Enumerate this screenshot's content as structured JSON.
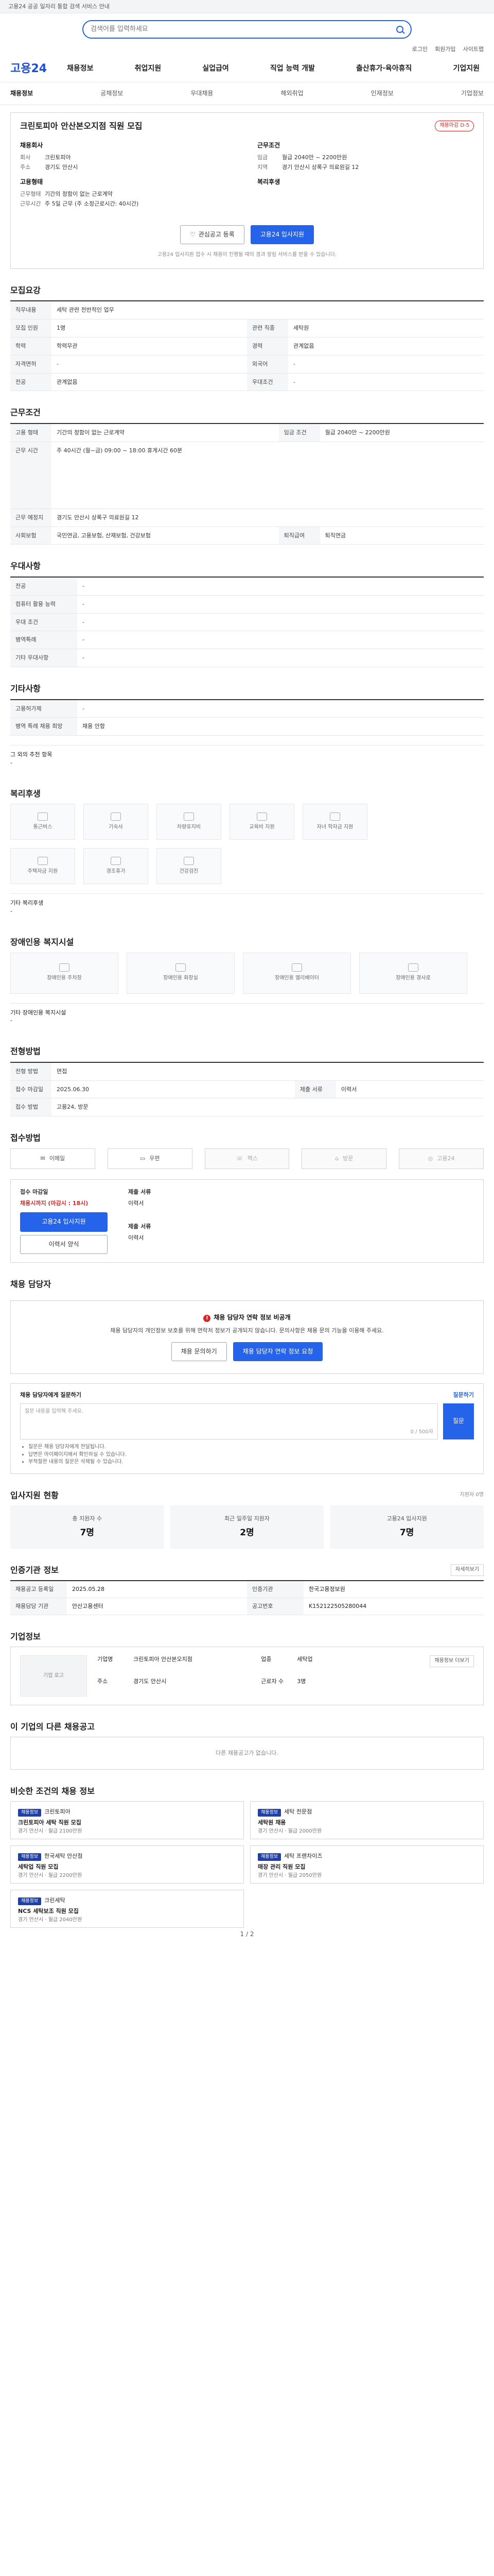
{
  "top": {
    "text": "고용24 공공 일자리 통합 검색 서비스 안내",
    "notice": ""
  },
  "search": {
    "placeholder": "검색어를 입력하세요"
  },
  "util": [
    "로그인",
    "회원가입",
    "사이트맵"
  ],
  "logo": "고용24",
  "gnb": [
    "채용정보",
    "취업지원",
    "실업급여",
    "직업 능력 개발",
    "출산휴가·육아휴직",
    "기업지원"
  ],
  "subnav": [
    "채용정보",
    "공채정보",
    "우대채용",
    "해외취업",
    "인재정보",
    "기업정보"
  ],
  "job": {
    "title": "크린토피아 안산본오지점 직원 모집",
    "dday": "채용마감 D-5",
    "company_h": "채용회사",
    "company_rows": [
      {
        "k": "회사",
        "v": "크린토피아"
      },
      {
        "k": "주소",
        "v": "경기도 안산시"
      }
    ],
    "cond_h": "근무조건",
    "cond_rows": [
      {
        "k": "임금",
        "v": "월급 2040만 ~ 2200만원"
      },
      {
        "k": "지역",
        "v": "경기 안산시 상록구 의료원길 12"
      }
    ],
    "emp_h": "고용형태",
    "emp_rows": [
      {
        "k": "근무형태",
        "v": "기간의 정함이 없는 근로계약"
      },
      {
        "k": "근무시간",
        "v": "주 5일 근무 (주 소정근로시간: 40시간)"
      }
    ],
    "welfare_h": "복리후생",
    "welfare_rows": []
  },
  "actions": {
    "scrap": "관심공고 등록",
    "apply": "고용24 입사지원"
  },
  "notice": "고용24 입사지원 접수 시 채용이 진행될 때의 결과 알림 서비스를 받을 수 있습니다.",
  "req": {
    "title": "모집요강",
    "rows": [
      {
        "k": "직무내용",
        "v": "세탁 관련 전반적인 업무",
        "full": true
      },
      {
        "k": "모집 인원",
        "v": "1명",
        "k2": "관련 직종",
        "v2": "세탁원"
      },
      {
        "k": "학력",
        "v": "학력무관",
        "k2": "경력",
        "v2": "관계없음"
      },
      {
        "k": "자격면허",
        "v": "-",
        "k2": "외국어",
        "v2": "-"
      },
      {
        "k": "전공",
        "v": "관계없음",
        "k2": "우대조건",
        "v2": "-"
      }
    ]
  },
  "work": {
    "title": "근무조건",
    "rows": [
      {
        "k": "고용 형태",
        "v": "기간의 정함이 없는 근로계약",
        "k2": "임금 조건",
        "v2": "월급 2040만 ~ 2200만원"
      },
      {
        "k": "근무 시간",
        "v": "주 40시간 (월~금) 09:00 ~ 18:00 휴게시간 60분",
        "k2": "",
        "v2": ""
      },
      {
        "k": "근무 예정지",
        "v": "경기도 안산시 상록구 의료원길 12",
        "k2": "",
        "v2": ""
      },
      {
        "k": "사회보험",
        "v": "국민연금, 고용보험, 산재보험, 건강보험",
        "k2": "퇴직급여",
        "v2": "퇴직연금"
      }
    ]
  },
  "pref": {
    "title": "우대사항",
    "rows": [
      {
        "k": "전공",
        "v": "-"
      },
      {
        "k": "컴퓨터 활용 능력",
        "v": "-"
      },
      {
        "k": "우대 조건",
        "v": "-"
      },
      {
        "k": "병역특례",
        "v": "-"
      },
      {
        "k": "기타 우대사항",
        "v": "-"
      }
    ]
  },
  "etc": {
    "title": "기타사항",
    "rows": [
      {
        "k": "고용허가제",
        "v": "-"
      },
      {
        "k": "병역 특례 채용 희망",
        "v": "채용 안함"
      }
    ],
    "extra_h": "그 외의 추천 항목",
    "extra": "-"
  },
  "welfare": {
    "title": "복리후생",
    "items": [
      "통근버스",
      "기숙사",
      "차량유지비",
      "교육비 지원",
      "자녀 학자금 지원",
      "주택자금 지원",
      "경조휴가",
      "건강검진"
    ],
    "etc_h": "기타 복리후생",
    "etc": "-"
  },
  "disabled": {
    "title": "장애인용 복지시설",
    "items": [
      "장애인용 주차장",
      "장애인용 화장실",
      "장애인용 엘리베이터",
      "장애인용 경사로"
    ],
    "etc_h": "기타 장애인용 복지시설",
    "etc": "-"
  },
  "process": {
    "title": "전형방법",
    "rows": [
      {
        "k": "전형 방법",
        "v": "면접"
      },
      {
        "k": "접수 마감일",
        "v": "2025.06.30",
        "k2": "제출 서류",
        "v2": "이력서"
      },
      {
        "k": "접수 방법",
        "v": "고용24, 방문"
      }
    ]
  },
  "methods": {
    "title": "접수방법",
    "items": [
      "이메일",
      "우편",
      "팩스",
      "방문",
      "고용24"
    ]
  },
  "apply": {
    "h1": "접수 마감일",
    "red": "채용시까지 (마감시 : 18시)",
    "btn1": "고용24 입사지원",
    "btn2": "이력서 양식",
    "h2": "제출 서류",
    "v2": "이력서",
    "h3": "제출 서류",
    "v3": "이력서"
  },
  "contact": {
    "title": "채용 담당자",
    "warn": "채용 담당자 연락 정보 비공개",
    "text": "채용 담당자의 개인정보 보호를 위해 연락처 정보가 공개되지 않습니다. 문의사항은 채용 문의 기능을 이용해 주세요.",
    "btn1": "채용 문의하기",
    "btn2": "채용 담당자 연락 정보 요청"
  },
  "inq": {
    "title": "채용 담당자에게 질문하기",
    "note": "질문하기",
    "placeholder": "질문 내용을 입력해 주세요.",
    "count": "0 / 500자",
    "btn": "질문",
    "tips": [
      "질문은 채용 담당자에게 전달됩니다.",
      "답변은 마이페이지에서 확인하실 수 있습니다.",
      "부적절한 내용의 질문은 삭제될 수 있습니다."
    ]
  },
  "stats": {
    "title": "입사지원 현황",
    "count": "지원자 0명",
    "items": [
      {
        "label": "총 지원자 수",
        "value": "7명"
      },
      {
        "label": "최근 일주일 지원자",
        "value": "2명"
      },
      {
        "label": "고용24 입사지원",
        "value": "7명"
      }
    ]
  },
  "mgmt": {
    "title": "인증기관 정보",
    "btn": "자세히보기",
    "rows": [
      {
        "k": "채용공고 등록일",
        "v": "2025.05.28",
        "k2": "인증기관",
        "v2": "한국고용정보원"
      },
      {
        "k": "채용담당 기관",
        "v": "안산고용센터",
        "k2": "공고번호",
        "v2": "K152122505280044"
      }
    ]
  },
  "company": {
    "title": "기업정보",
    "btn": "채용정보 더보기",
    "logo": "기업 로고",
    "rows": [
      {
        "k": "기업명",
        "v": "크린토피아 안산본오지점"
      },
      {
        "k": "업종",
        "v": "세탁업"
      },
      {
        "k": "주소",
        "v": "경기도 안산시"
      },
      {
        "k": "근로자 수",
        "v": "3명"
      }
    ]
  },
  "rec": {
    "title": "이 기업의 다른 채용공고",
    "empty": "다른 채용공고가 없습니다."
  },
  "similar": {
    "title": "비슷한 조건의 채용 정보",
    "page": "1 / 2",
    "items": [
      {
        "badge": "채용정보",
        "company": "크린토피아",
        "title": "크린토피아 세탁 직원 모집",
        "meta": "경기 안산시 · 월급 2100만원"
      },
      {
        "badge": "채용정보",
        "company": "세탁 전문점",
        "title": "세탁원 채용",
        "meta": "경기 안산시 · 월급 2000만원"
      },
      {
        "badge": "채용정보",
        "company": "한국세탁 안산점",
        "title": "세탁업 직원 모집",
        "meta": "경기 안산시 · 월급 2200만원"
      },
      {
        "badge": "채용정보",
        "company": "세탁 프랜차이즈",
        "title": "매장 관리 직원 모집",
        "meta": "경기 안산시 · 월급 2050만원"
      },
      {
        "badge": "채용정보",
        "company": "크린세탁",
        "title": "NCS 세탁보조 직원 모집",
        "meta": "경기 안산시 · 월급 2040만원"
      }
    ]
  }
}
